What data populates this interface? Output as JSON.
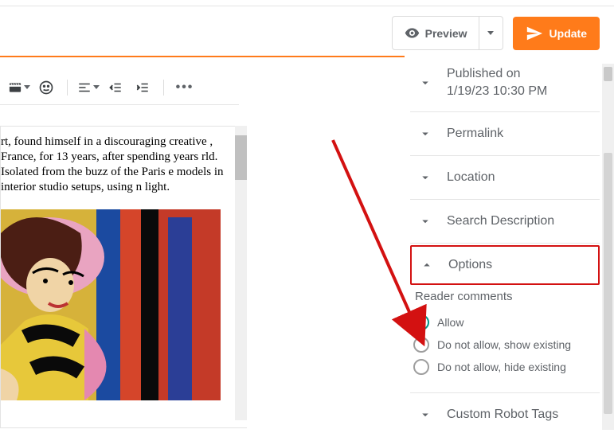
{
  "header": {
    "preview": "Preview",
    "update": "Update"
  },
  "doc": {
    "paragraph": "rt, found himself in a discouraging creative , France, for 13 years, after spending years rld. Isolated from the buzz of the Paris e models in interior studio setups, using n light."
  },
  "sidebar": {
    "published_label": "Published on",
    "published_value": "1/19/23 10:30 PM",
    "permalink": "Permalink",
    "location": "Location",
    "search_desc": "Search Description",
    "options": "Options",
    "reader_comments": "Reader comments",
    "radio_allow": "Allow",
    "radio_show": "Do not allow, show existing",
    "radio_hide": "Do not allow, hide existing",
    "custom_robots": "Custom Robot Tags"
  }
}
